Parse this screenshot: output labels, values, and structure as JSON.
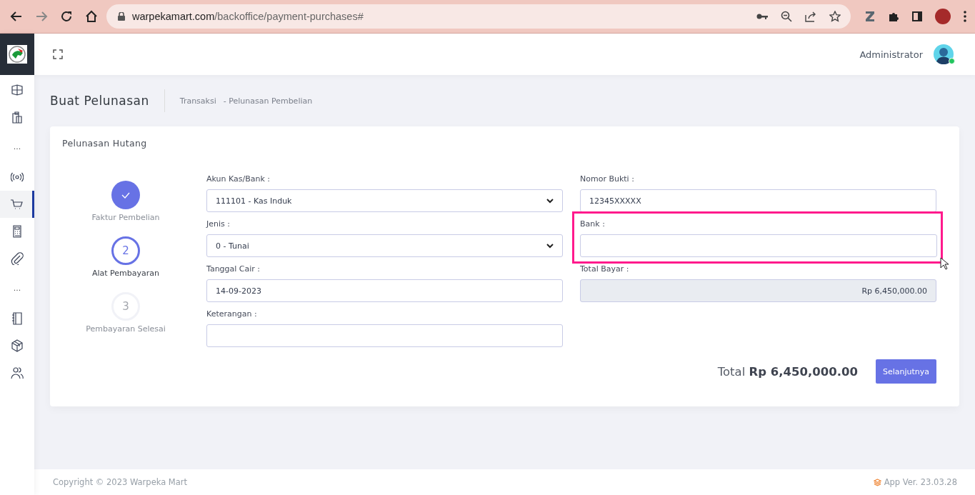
{
  "browser": {
    "url_host": "warpekamart.com",
    "url_path": "/backoffice/payment-purchases#"
  },
  "sidebar": {
    "items": [
      {
        "kind": "icon",
        "selected": false
      },
      {
        "kind": "icon",
        "selected": false
      },
      {
        "kind": "separator",
        "label": "..."
      },
      {
        "kind": "icon",
        "selected": false
      },
      {
        "kind": "icon",
        "selected": true
      },
      {
        "kind": "icon",
        "selected": false
      },
      {
        "kind": "icon",
        "selected": false
      },
      {
        "kind": "separator",
        "label": "..."
      },
      {
        "kind": "icon",
        "selected": false
      },
      {
        "kind": "icon",
        "selected": false
      },
      {
        "kind": "icon",
        "selected": false
      }
    ]
  },
  "header": {
    "user": "Administrator",
    "online": true
  },
  "page": {
    "title": "Buat Pelunasan",
    "breadcrumb": [
      "Transaksi",
      "- Pelunasan Pembelian"
    ]
  },
  "card": {
    "title": "Pelunasan Hutang",
    "steps": [
      {
        "label": "Faktur Pembelian",
        "done": true,
        "selected": false
      },
      {
        "number": "2",
        "label": "Alat Pembayaran",
        "done": false,
        "selected": true
      },
      {
        "number": "3",
        "label": "Pembayaran Selesai",
        "done": false,
        "selected": false
      }
    ],
    "left_fields": [
      {
        "label": "Akun Kas/Bank :",
        "kind": "select",
        "value": "111101 - Kas Induk",
        "highlighted": false
      },
      {
        "label": "Jenis :",
        "kind": "select",
        "value": "0 - Tunai",
        "highlighted": false
      },
      {
        "label": "Tanggal Cair :",
        "kind": "input",
        "value": "14-09-2023",
        "highlighted": false
      },
      {
        "label": "Keterangan :",
        "kind": "input",
        "highlighted": false
      }
    ],
    "right_fields": [
      {
        "label": "Nomor Bukti :",
        "kind": "input",
        "value": "12345XXXXX",
        "highlighted": false
      },
      {
        "label": "Bank :",
        "kind": "input",
        "highlighted": true
      },
      {
        "label": "Total Bayar :",
        "kind": "readonly",
        "value": "Rp 6,450,000.00",
        "highlighted": false
      }
    ],
    "total_label": "Total",
    "total_value": "Rp 6,450,000.00",
    "next_button": "Selanjutnya"
  },
  "footer": {
    "copyright": "Copyright © 2023 Warpeka Mart",
    "version": "App Ver. 23.03.28"
  }
}
